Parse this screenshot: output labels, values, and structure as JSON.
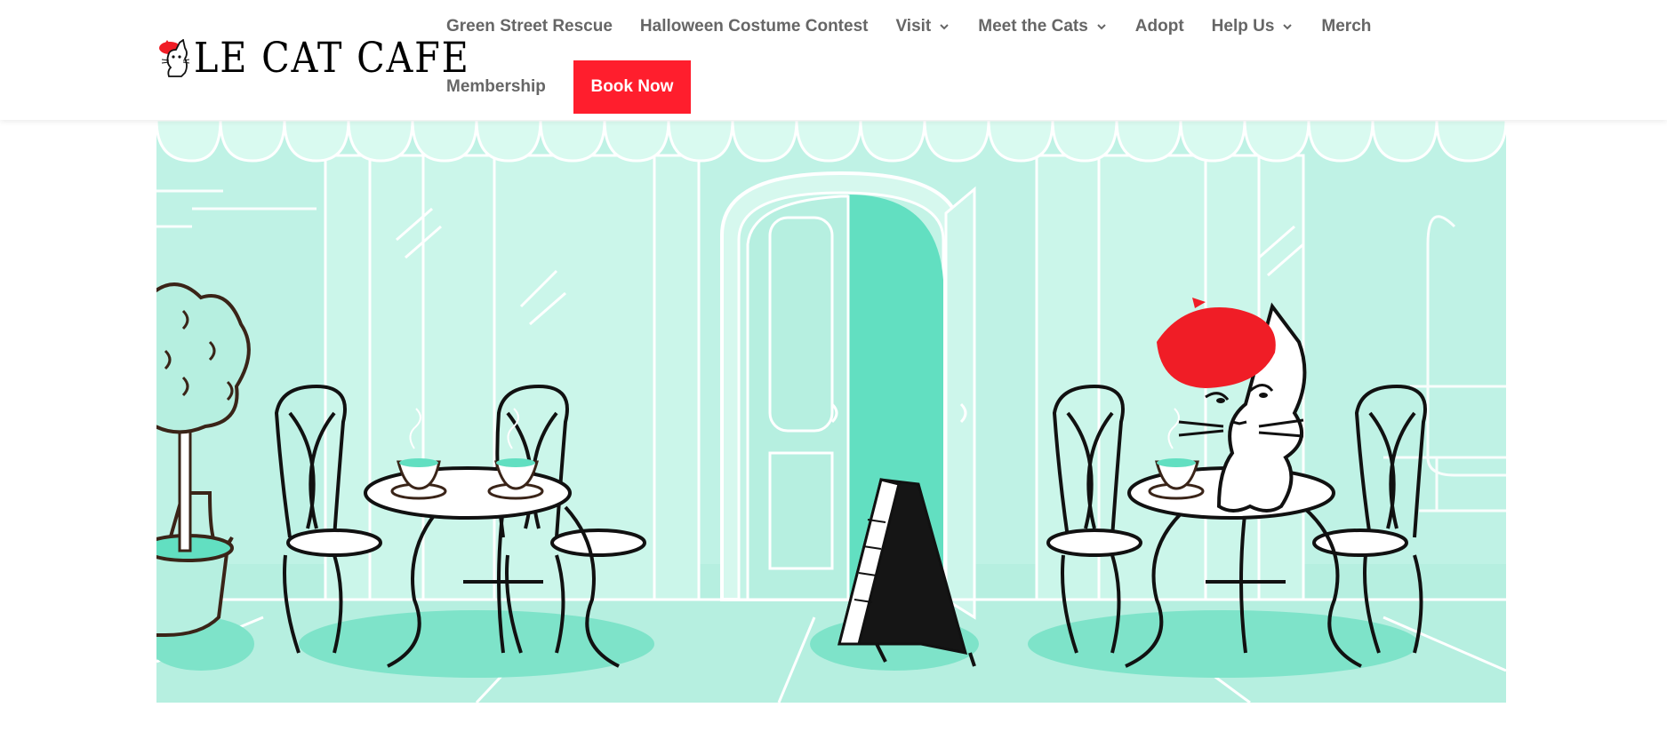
{
  "brand": {
    "name": "LE CAT CAFE",
    "logo_icon": "cat-with-beret-icon",
    "accent": "#ff1e2d"
  },
  "nav": {
    "items": [
      {
        "label": "Green Street Rescue",
        "dropdown": false
      },
      {
        "label": "Halloween Costume Contest",
        "dropdown": false
      },
      {
        "label": "Visit",
        "dropdown": true
      },
      {
        "label": "Meet the Cats",
        "dropdown": true
      },
      {
        "label": "Adopt",
        "dropdown": false
      },
      {
        "label": "Help Us",
        "dropdown": true
      },
      {
        "label": "Merch",
        "dropdown": false
      },
      {
        "label": "Membership",
        "dropdown": false
      }
    ],
    "cta": {
      "label": "Book Now",
      "color": "#ff1e2d"
    }
  },
  "hero": {
    "illustration": "cafe-storefront-illustration",
    "colors": {
      "mint_light": "#c4f3e6",
      "mint": "#a8ebd8",
      "door_open": "#62dfc1",
      "outline": "#1a1a1a",
      "beret": "#f01d26"
    }
  }
}
